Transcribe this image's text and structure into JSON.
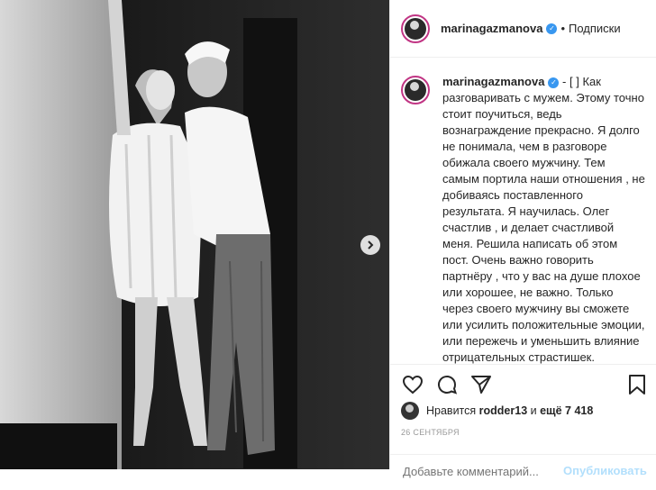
{
  "post": {
    "username": "marinagazmanova",
    "follow_label": "Подписки",
    "separator": "•"
  },
  "caption": {
    "username": "marinagazmanova",
    "text": " - [ ] Как разговаривать с мужем. Этому точно стоит поучиться, ведь вознаграждение прекрасно. Я долго не понимала, чем в разговоре обижала своего мужчину. Тем самым портила наши отношения , не добиваясь поставленного результата. Я научилась. Олег счастлив , и делает счастливой меня. Решила написать об этом пост. Очень важно говорить партнёру , что у вас на душе плохое или хорошее, не важно. Только через своего мужчину вы сможете или усилить положительные эмоции, или пережечь и уменьшить влияние отрицательных страстишек. Говорите понятными фразами, не"
  },
  "likes": {
    "prefix": "Нравится",
    "user": "rodder13",
    "conj": "и",
    "rest": "ещё 7 418"
  },
  "date": "26 СЕНТЯБРЯ",
  "comment": {
    "placeholder": "Добавьте комментарий...",
    "publish": "Опубликовать"
  },
  "icons": {
    "verified": "verified-badge-icon",
    "like": "heart-icon",
    "comment": "speech-bubble-icon",
    "share": "paper-plane-icon",
    "save": "bookmark-icon",
    "next": "chevron-right-icon"
  },
  "colors": {
    "verified": "#3897f0",
    "avatar_ring": "#c13584",
    "publish_disabled": "#b2dffc"
  }
}
